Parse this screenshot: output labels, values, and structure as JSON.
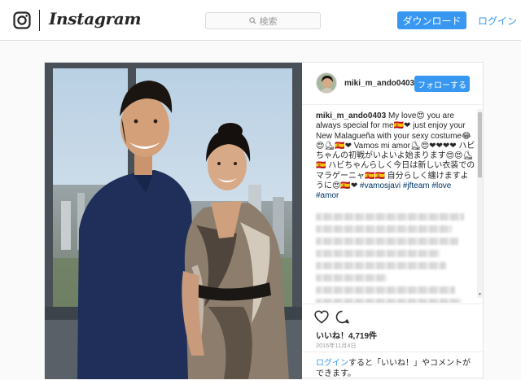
{
  "brand": {
    "wordmark": "Instagram",
    "accent": "#3897f0"
  },
  "nav": {
    "search_placeholder": "検索",
    "download_label": "ダウンロード",
    "login_label": "ログイン"
  },
  "post": {
    "username": "miki_m_ando0403",
    "follow_label": "フォローする",
    "caption": {
      "author": "miki_m_ando0403",
      "text": " My love😍 you are always special for me🇪🇸❤ just enjoy your New Malagueña with your sexy costume😂😍⛸🇪🇸❤ Vamos mi amor⛸😍❤❤❤❤ ハビちゃんの初戦がいよいよ始まります😍😍⛸🇪🇸 ハビちゃんらしく今日は新しい衣装でのマラゲーニャ🇪🇸🇪🇸 自分らしく纏けますように😍🇪🇸❤ ",
      "hashtags": "#vamosjavi #jfteam #love #amor"
    },
    "likes": "いいね！4,719件",
    "date": "2016年11月4日",
    "login_prompt": {
      "link": "ログイン",
      "text": "すると「いいね！」やコメントができます。"
    },
    "icons": {
      "like": "heart-icon",
      "comment": "comment-icon",
      "logo": "instagram-camera-icon",
      "search": "search-icon"
    }
  }
}
